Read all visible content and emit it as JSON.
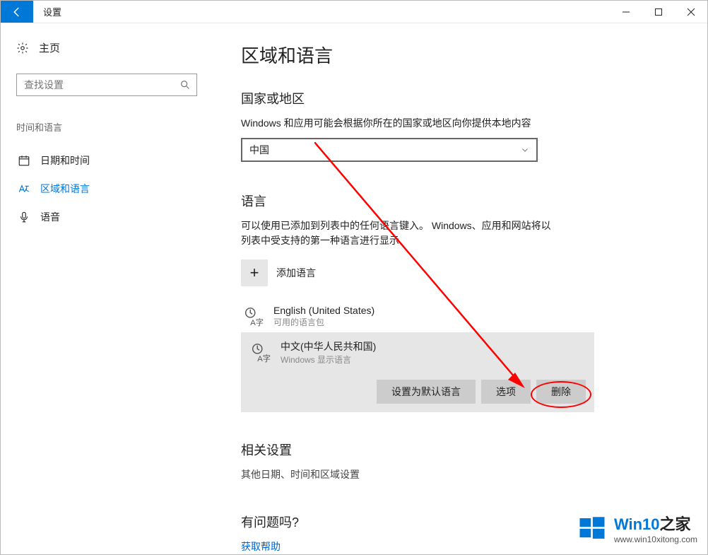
{
  "window": {
    "title": "设置"
  },
  "sidebar": {
    "home": "主页",
    "search_placeholder": "查找设置",
    "section_label": "时间和语言",
    "items": [
      {
        "label": "日期和时间"
      },
      {
        "label": "区域和语言"
      },
      {
        "label": "语音"
      }
    ]
  },
  "main": {
    "page_title": "区域和语言",
    "region": {
      "heading": "国家或地区",
      "desc": "Windows 和应用可能会根据你所在的国家或地区向你提供本地内容",
      "selected": "中国"
    },
    "language": {
      "heading": "语言",
      "desc": "可以使用已添加到列表中的任何语言键入。 Windows、应用和网站将以列表中受支持的第一种语言进行显示",
      "add_label": "添加语言",
      "items": [
        {
          "name": "English (United States)",
          "sub": "可用的语言包"
        },
        {
          "name": "中文(中华人民共和国)",
          "sub": "Windows 显示语言"
        }
      ],
      "buttons": {
        "set_default": "设置为默认语言",
        "options": "选项",
        "remove": "删除"
      }
    },
    "related": {
      "heading": "相关设置",
      "link": "其他日期、时间和区域设置"
    },
    "qa": {
      "heading": "有问题吗?",
      "link": "获取帮助"
    }
  },
  "watermark": {
    "brand_prefix": "Win10",
    "brand_suffix": "之家",
    "url": "www.win10xitong.com"
  }
}
